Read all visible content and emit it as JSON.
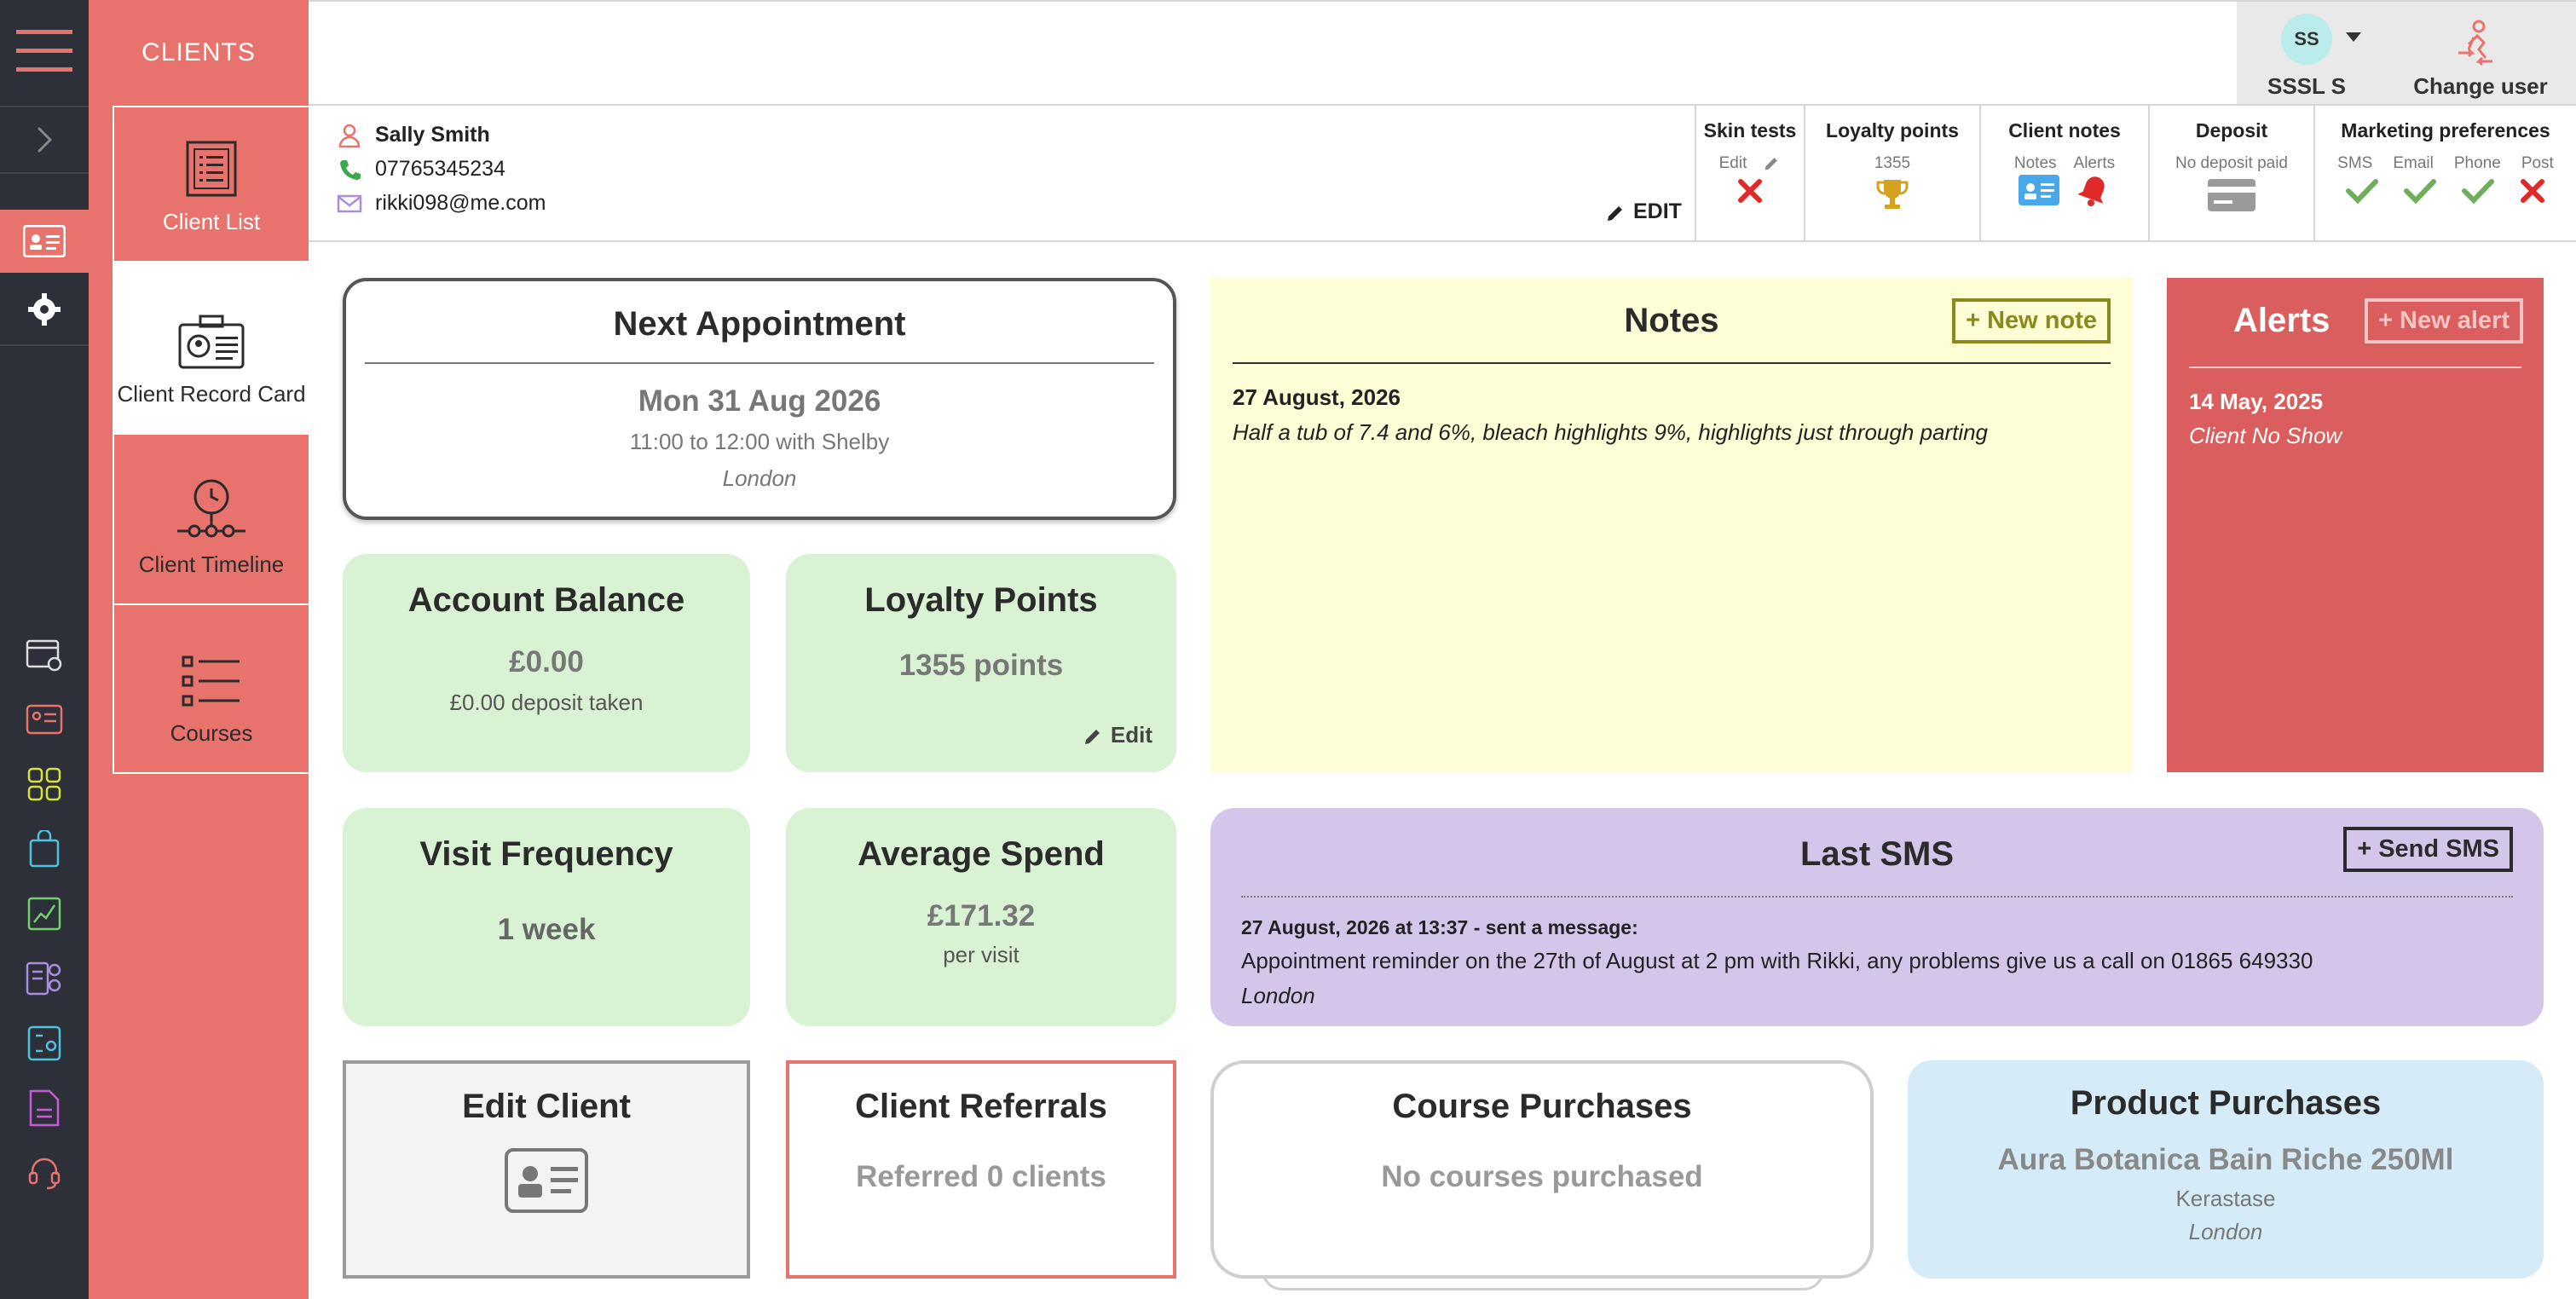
{
  "nav": {
    "clients_title": "CLIENTS",
    "items": [
      {
        "label": "Client List"
      },
      {
        "label": "Client Record Card"
      },
      {
        "label": "Client Timeline"
      },
      {
        "label": "Courses"
      }
    ]
  },
  "user": {
    "initials": "SS",
    "name": "SSSL S",
    "change_label": "Change user"
  },
  "client": {
    "name": "Sally Smith",
    "phone": "07765345234",
    "email": "rikki098@me.com",
    "edit_label": "EDIT"
  },
  "prefs": {
    "skin_tests": {
      "title": "Skin tests",
      "edit": "Edit"
    },
    "loyalty": {
      "title": "Loyalty points",
      "value": "1355"
    },
    "client_notes": {
      "title": "Client notes",
      "notes": "Notes",
      "alerts": "Alerts"
    },
    "deposit": {
      "title": "Deposit",
      "value": "No deposit paid"
    },
    "marketing": {
      "title": "Marketing preferences",
      "sms": "SMS",
      "email": "Email",
      "phone": "Phone",
      "post": "Post"
    }
  },
  "appointment": {
    "title": "Next Appointment",
    "date": "Mon 31 Aug 2026",
    "time": "11:00 to 12:00 with Shelby",
    "location": "London"
  },
  "balance": {
    "title": "Account Balance",
    "value": "£0.00",
    "deposit": "£0.00 deposit taken"
  },
  "loyalty": {
    "title": "Loyalty Points",
    "value": "1355 points",
    "edit": "Edit"
  },
  "visit": {
    "title": "Visit Frequency",
    "value": "1 week"
  },
  "spend": {
    "title": "Average Spend",
    "value": "£171.32",
    "sub": "per visit"
  },
  "notes": {
    "title": "Notes",
    "new_label": "+ New note",
    "date": "27 August, 2026",
    "text": "Half a tub of 7.4 and 6%, bleach highlights 9%, highlights just through parting"
  },
  "alerts": {
    "title": "Alerts",
    "new_label": "+ New alert",
    "date": "14 May, 2025",
    "text": "Client No Show"
  },
  "sms": {
    "title": "Last SMS",
    "send_label": "+ Send SMS",
    "meta": "27 August, 2026 at 13:37 - sent a message:",
    "text": "Appointment reminder on the 27th of August at 2 pm with Rikki, any problems give us a call on 01865 649330",
    "location": "London"
  },
  "edit_client": {
    "title": "Edit Client"
  },
  "referrals": {
    "title": "Client Referrals",
    "value": "Referred 0 clients"
  },
  "courses": {
    "title": "Course Purchases",
    "value": "No courses purchased"
  },
  "products": {
    "title": "Product Purchases",
    "name": "Aura Botanica Bain Riche 250Ml",
    "brand": "Kerastase",
    "location": "London"
  },
  "colors": {
    "accent": "#e8736c",
    "alert": "#db5e5e",
    "green": "#d9f2d3",
    "notes": "#fdfed6",
    "sms": "#d4c6ea",
    "product": "#d5ecf8"
  }
}
